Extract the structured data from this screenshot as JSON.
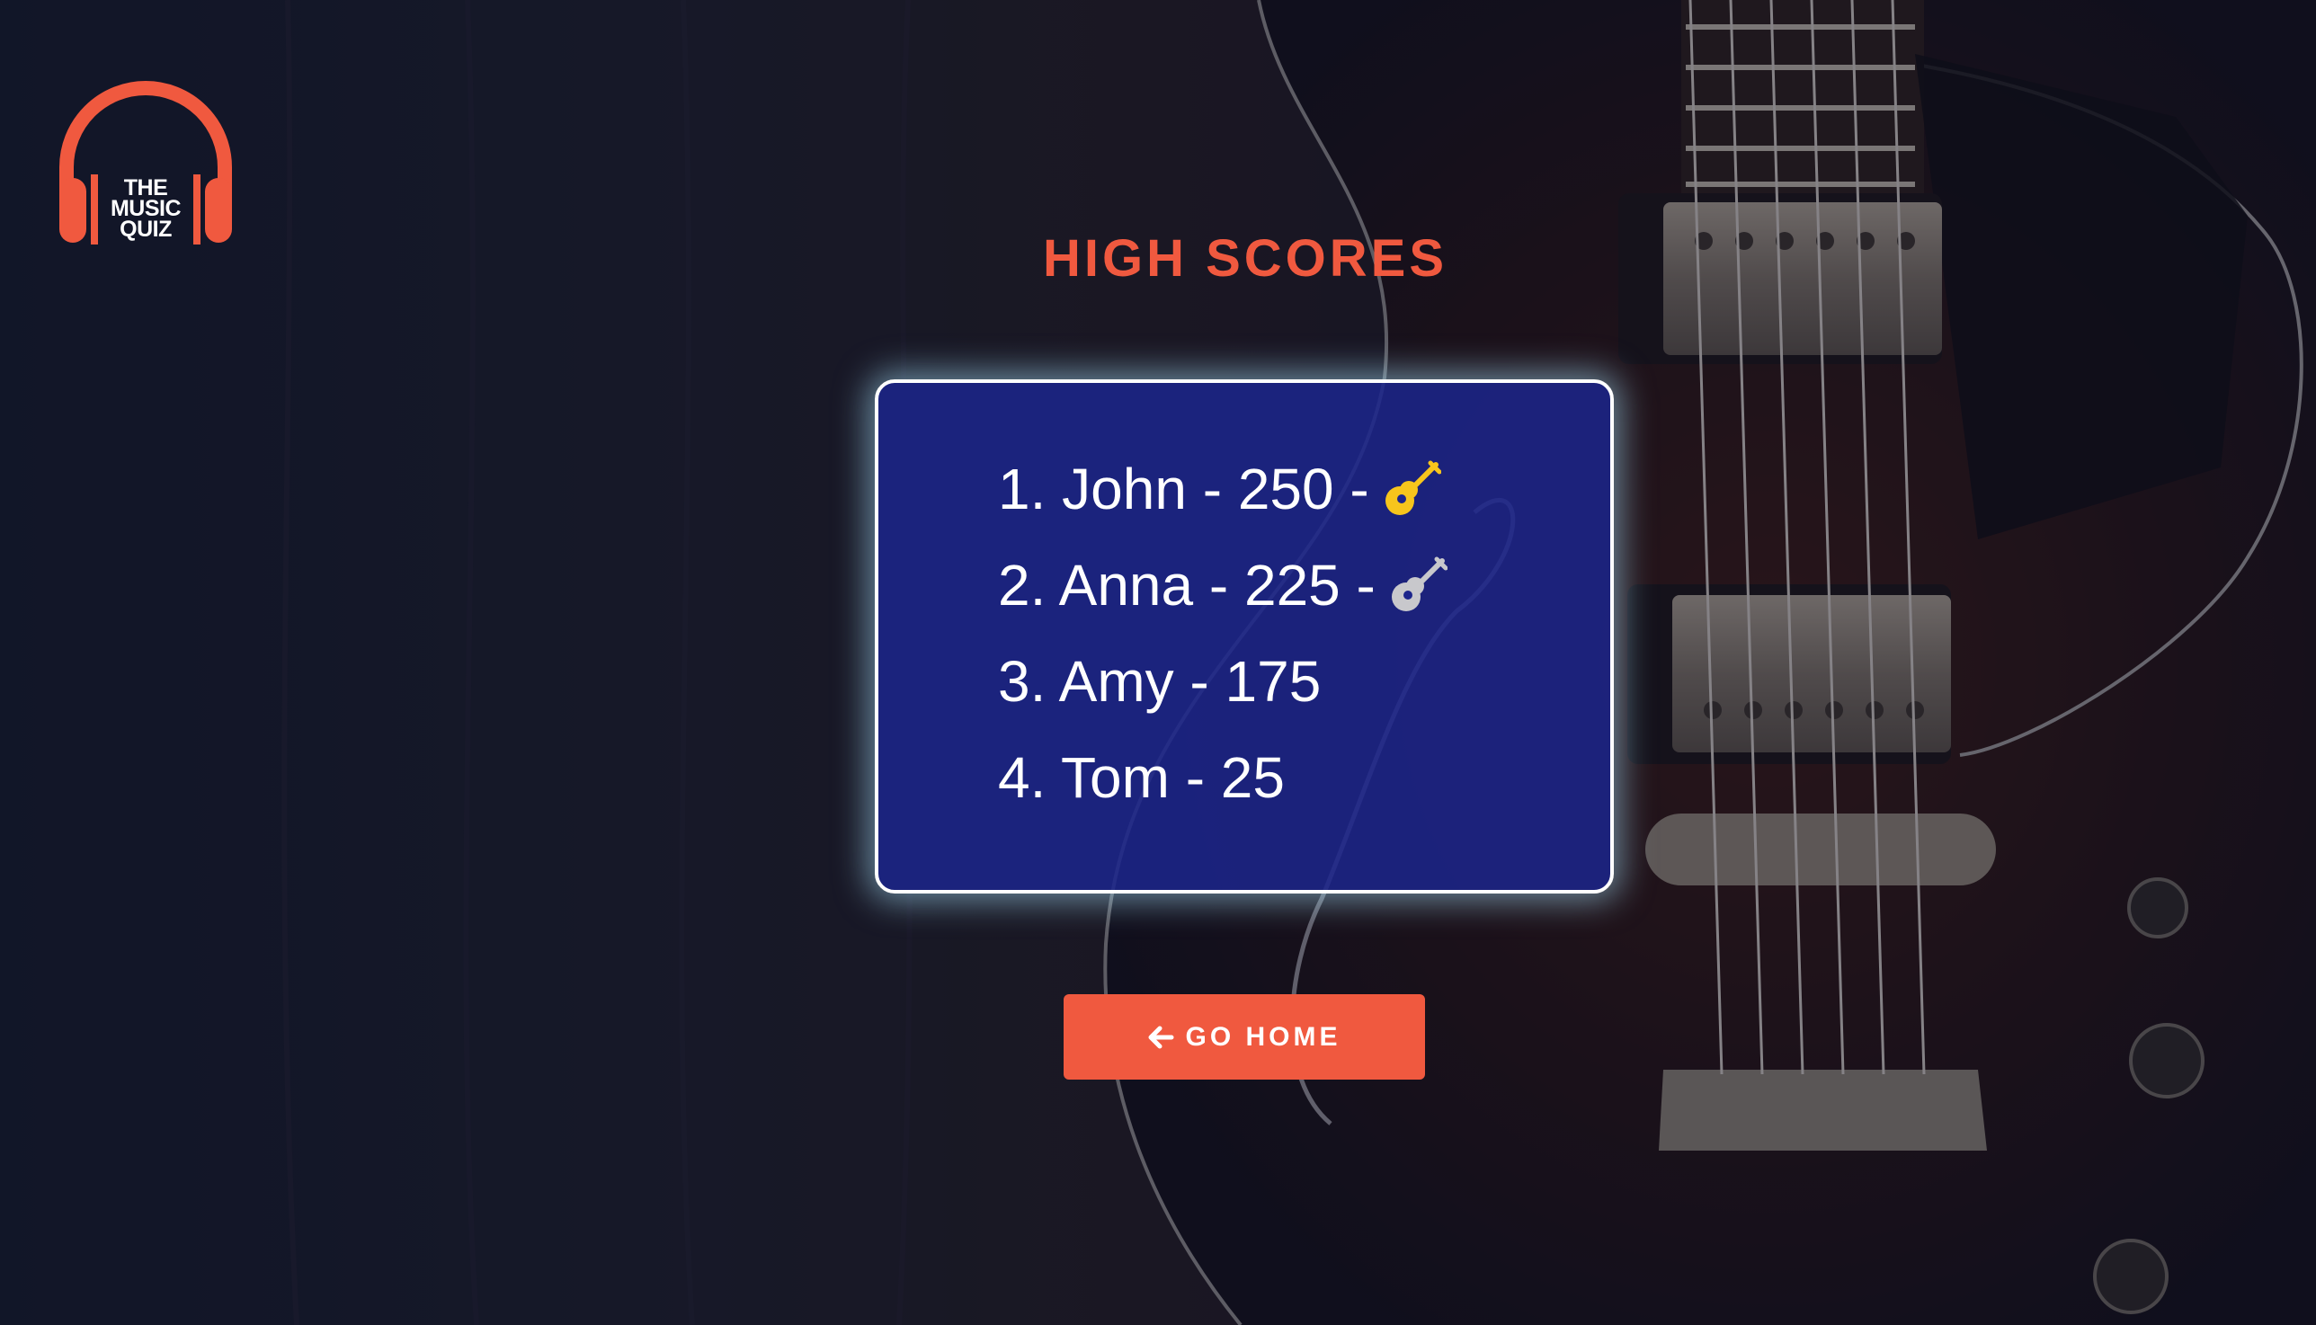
{
  "app": {
    "logo_lines": [
      "THE",
      "MUSIC",
      "QUIZ"
    ]
  },
  "page": {
    "title": "HIGH SCORES"
  },
  "scores": [
    {
      "text": "1. John - 250 -",
      "icon": "gold-guitar-icon",
      "icon_color": "#f7c51c"
    },
    {
      "text": "2. Anna - 225 -",
      "icon": "silver-guitar-icon",
      "icon_color": "#c8c8cc"
    },
    {
      "text": "3. Amy - 175",
      "icon": "",
      "icon_color": ""
    },
    {
      "text": "4. Tom - 25",
      "icon": "",
      "icon_color": ""
    }
  ],
  "home_button": {
    "label": "GO HOME",
    "icon": "arrow-left-icon"
  },
  "colors": {
    "accent": "#f0593f",
    "card_background": "#1c258c",
    "page_background": "#15192a"
  },
  "background_image": "electric-guitar-photo"
}
